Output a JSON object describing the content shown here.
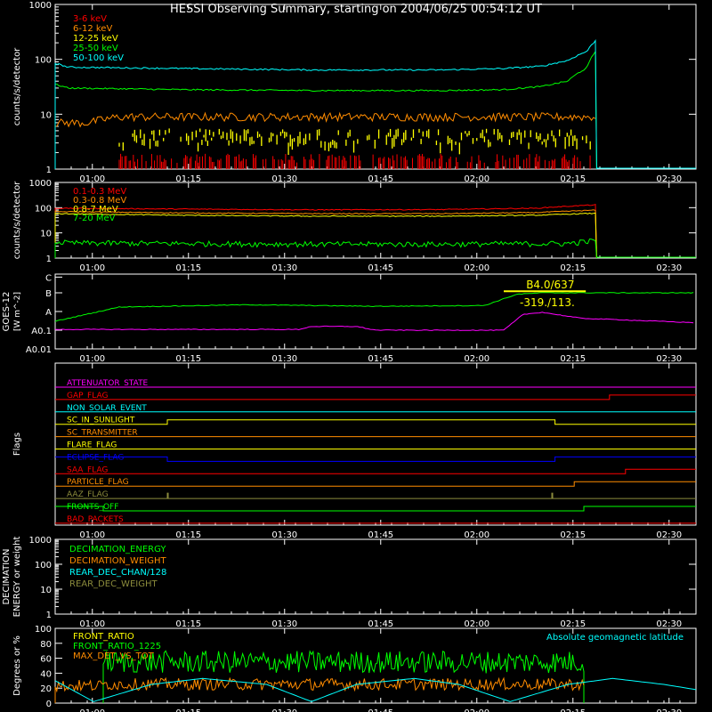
{
  "title": "HESSI Observing Summary, starting on 2004/06/25 00:54:12 UT",
  "colors": {
    "background": "#000000",
    "axis": "#ffffff",
    "red": "#ff0000",
    "orange": "#ff8c00",
    "yellow": "#ffff00",
    "green": "#00ff00",
    "cyan": "#00ffff",
    "magenta": "#ff00ff",
    "blue": "#0000ff",
    "olive": "#8c8c3c"
  },
  "x_tick_labels": [
    "01:00",
    "01:15",
    "01:30",
    "01:45",
    "02:00",
    "02:15",
    "02:30"
  ],
  "chart_data": [
    {
      "type": "line",
      "panel": "lightcurve-low",
      "x_unit": "minutes since 00:54:12 UT",
      "xlim": [
        0,
        100
      ],
      "ylabel": "counts/s/detector",
      "yscale": "log",
      "ylim": [
        1,
        1000
      ],
      "y_tick_labels": [
        "1",
        "10",
        "100",
        "1000"
      ],
      "legend_position": "top-left",
      "data_range_minutes": [
        0,
        84.5
      ],
      "series": [
        {
          "name": "3-6 keV",
          "color": "#ff0000",
          "x": [
            10,
            19,
            80
          ],
          "y": [
            1.0,
            1.7,
            1.7
          ]
        },
        {
          "name": "6-12 keV",
          "color": "#ff8c00",
          "x": [
            0,
            5,
            10,
            40,
            78,
            84
          ],
          "y": [
            7,
            7,
            9,
            9,
            9,
            9
          ]
        },
        {
          "name": "12-25 keV",
          "color": "#ffff00",
          "x": [
            0,
            10,
            40,
            80,
            84
          ],
          "y": [
            7,
            5,
            5,
            4,
            7
          ]
        },
        {
          "name": "25-50 keV",
          "color": "#00ff00",
          "x": [
            0,
            2,
            20,
            40,
            60,
            70,
            76,
            80,
            83,
            84.5
          ],
          "y": [
            35,
            30,
            28,
            27,
            27,
            28,
            32,
            40,
            70,
            150
          ]
        },
        {
          "name": "50-100 keV",
          "color": "#00ffff",
          "x": [
            0,
            2,
            20,
            40,
            60,
            70,
            76,
            80,
            83,
            84.5
          ],
          "y": [
            85,
            72,
            68,
            64,
            64,
            68,
            75,
            95,
            140,
            230
          ]
        }
      ]
    },
    {
      "type": "line",
      "panel": "lightcurve-high",
      "xlim": [
        0,
        100
      ],
      "ylabel": "counts/s/detector",
      "yscale": "log",
      "ylim": [
        1,
        1000
      ],
      "y_tick_labels": [
        "1",
        "10",
        "100",
        "1000"
      ],
      "legend_position": "top-left",
      "series": [
        {
          "name": "0.1-0.3 MeV",
          "color": "#ff0000",
          "x": [
            0,
            20,
            40,
            60,
            75,
            84.5
          ],
          "y": [
            95,
            88,
            82,
            84,
            95,
            130
          ]
        },
        {
          "name": "0.3-0.8 MeV",
          "color": "#ff8c00",
          "x": [
            0,
            20,
            40,
            60,
            75,
            84.5
          ],
          "y": [
            70,
            62,
            58,
            58,
            64,
            80
          ]
        },
        {
          "name": "0.8-7 MeV",
          "color": "#ffff00",
          "x": [
            0,
            20,
            40,
            60,
            75,
            84.5
          ],
          "y": [
            58,
            50,
            46,
            46,
            50,
            60
          ]
        },
        {
          "name": "7-20 MeV",
          "color": "#00ff00",
          "x": [
            0,
            2,
            20,
            40,
            60,
            80,
            84.5
          ],
          "y": [
            4.5,
            4.0,
            3.8,
            3.6,
            3.6,
            3.8,
            5.0
          ]
        }
      ]
    },
    {
      "type": "line",
      "panel": "goes",
      "xlim": [
        0,
        100
      ],
      "ylabel": "GOES-12 [W m^-2]",
      "y_tick_labels": [
        "A0.01",
        "A0.1",
        "A",
        "B",
        "C"
      ],
      "annotations": [
        "B4.0/637",
        "-319./113."
      ],
      "series": [
        {
          "name": "GOES low",
          "color": "#00ff00",
          "x": [
            0,
            10,
            30,
            50,
            67,
            72,
            76,
            100
          ],
          "y": [
            0.12,
            0.31,
            0.34,
            0.32,
            0.33,
            0.48,
            0.5,
            0.5
          ]
        },
        {
          "name": "GOES high",
          "color": "#ff00ff",
          "x": [
            0,
            38,
            40,
            47,
            50,
            70,
            73,
            76,
            82,
            100
          ],
          "y": [
            0.01,
            0.01,
            0.05,
            0.05,
            0.0,
            0.0,
            0.21,
            0.24,
            0.16,
            0.1
          ]
        },
        {
          "name": "GOES window",
          "color": "#ffff00",
          "x": [
            70,
            83
          ],
          "y": [
            0.52,
            0.52
          ]
        }
      ]
    },
    {
      "type": "line",
      "panel": "flags",
      "xlim": [
        0,
        100
      ],
      "ylabel": "Flags",
      "flags": [
        {
          "name": "ATTENUATOR_STATE",
          "color": "#ff00ff",
          "transitions": []
        },
        {
          "name": "GAP_FLAG",
          "color": "#ff0000",
          "transitions": [
            [
              86.5,
              1
            ]
          ]
        },
        {
          "name": "NON_SOLAR_EVENT",
          "color": "#00ffff",
          "transitions": []
        },
        {
          "name": "SC_IN_SUNLIGHT",
          "color": "#ffff00",
          "transitions": [
            [
              17.5,
              1
            ],
            [
              78,
              0
            ]
          ]
        },
        {
          "name": "SC_TRANSMITTER",
          "color": "#ff8c00",
          "transitions": []
        },
        {
          "name": "FLARE_FLAG",
          "color": "#ffff00",
          "transitions": []
        },
        {
          "name": "ECLIPSE_FLAG",
          "color": "#0000ff",
          "transitions": [
            [
              17.5,
              0
            ],
            [
              78,
              1
            ]
          ]
        },
        {
          "name": "SAA_FLAG",
          "color": "#ff0000",
          "transitions": [
            [
              89,
              1
            ]
          ]
        },
        {
          "name": "PARTICLE_FLAG",
          "color": "#ff8c00",
          "transitions": [
            [
              81,
              1
            ]
          ]
        },
        {
          "name": "AAZ_FLAG",
          "color": "#8c8c3c",
          "spikes": [
            17.5,
            77.5
          ]
        },
        {
          "name": "FRONTS_OFF",
          "color": "#00ff00",
          "transitions": [
            [
              7.5,
              0
            ],
            [
              82.5,
              1
            ]
          ]
        },
        {
          "name": "BAD_PACKETS",
          "color": "#ff0000",
          "transitions": []
        }
      ]
    },
    {
      "type": "line",
      "panel": "decimation",
      "xlim": [
        0,
        100
      ],
      "ylabel": "DECIMATION ENERGY or weight",
      "yscale": "log",
      "ylim": [
        1,
        1000
      ],
      "y_tick_labels": [
        "1",
        "10",
        "100",
        "1000"
      ],
      "series": [
        {
          "name": "DECIMATION_ENERGY",
          "color": "#00ff00"
        },
        {
          "name": "DECIMATION_WEIGHT",
          "color": "#ff8c00"
        },
        {
          "name": "REAR_DEC_CHAN/128",
          "color": "#00ffff"
        },
        {
          "name": "REAR_DEC_WEIGHT",
          "color": "#8c8c3c"
        }
      ]
    },
    {
      "type": "line",
      "panel": "ratios",
      "xlim": [
        0,
        100
      ],
      "ylabel": "Degrees or %",
      "ylim": [
        0,
        100
      ],
      "y_tick_labels": [
        "0",
        "20",
        "40",
        "60",
        "80",
        "100"
      ],
      "right_label": "Absolute geomagnetic latitude",
      "series": [
        {
          "name": "FRONT_RATIO",
          "color": "#ffff00"
        },
        {
          "name": "FRONT_RATIO_1225",
          "color": "#00ff00",
          "x": [
            7.5,
            82.5
          ],
          "y": [
            55,
            55
          ]
        },
        {
          "name": "MAX_DET_VS_TOT",
          "color": "#ff8c00",
          "x": [
            0,
            82.5
          ],
          "y": [
            22,
            22
          ]
        },
        {
          "name": "Absolute geomagnetic latitude",
          "color": "#00ffff",
          "x": [
            0,
            6,
            15,
            23,
            33,
            40,
            47,
            56,
            63,
            71,
            80,
            87,
            95,
            100
          ],
          "y": [
            30,
            2,
            25,
            33,
            25,
            2,
            25,
            33,
            25,
            2,
            25,
            33,
            25,
            18
          ]
        }
      ]
    }
  ]
}
